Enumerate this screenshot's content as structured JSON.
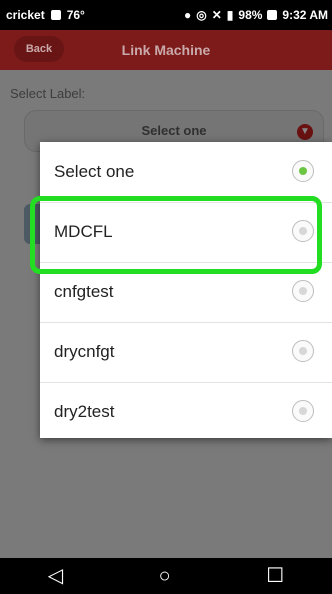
{
  "statusbar": {
    "carrier": "cricket",
    "temp": "76°",
    "battery": "98%",
    "time": "9:32 AM"
  },
  "titlebar": {
    "back_label": "Back",
    "title": "Link Machine"
  },
  "form": {
    "select_label": "Select Label:",
    "dropdown_value": "Select one"
  },
  "dialog": {
    "options": [
      {
        "label": "Select one",
        "selected": true
      },
      {
        "label": "MDCFL",
        "selected": false
      },
      {
        "label": "cnfgtest",
        "selected": false
      },
      {
        "label": "drycnfgt",
        "selected": false
      },
      {
        "label": "dry2test",
        "selected": false
      }
    ]
  },
  "colors": {
    "accent": "#7d1a1a",
    "highlight": "#22dd22",
    "radio_selected": "#6cc644"
  }
}
